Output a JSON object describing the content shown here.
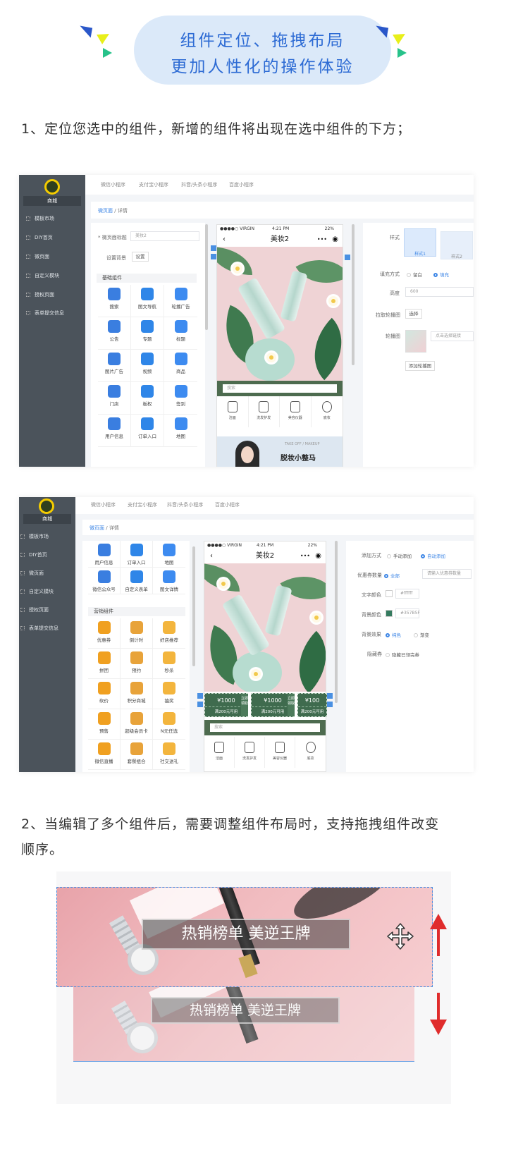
{
  "header": {
    "line1": "组件定位、拖拽布局",
    "line2": "更加人性化的操作体验",
    "accent": "#2d6bd4"
  },
  "captions": {
    "one": "1、定位您选中的组件，新增的组件将出现在选中组件的下方；",
    "two_a": "2、当编辑了多个组件后，需要调整组件布局时，支持拖拽组件改变",
    "two_b": "顺序。"
  },
  "sidebar": {
    "store": "商城",
    "items": [
      "模板市场",
      "DIY首页",
      "微页面",
      "自定义模块",
      "授权页面",
      "表单提交信息"
    ]
  },
  "topbar": {
    "tabs": [
      "微信小程序",
      "支付宝小程序",
      "抖音/头条小程序",
      "百度小程序"
    ]
  },
  "breadcrumb": {
    "parent": "微页面",
    "sep": "/",
    "current": "详情"
  },
  "shot1": {
    "form": {
      "title_label": "* 微页面标题",
      "title_value": "美妆2",
      "bg_label": "设置背景",
      "bg_button": "设置"
    },
    "section": "基础组件",
    "widgets": [
      "搜索",
      "图文导航",
      "轮播广告",
      "公告",
      "专题",
      "标题",
      "图片广告",
      "视频",
      "商品",
      "门店",
      "板权",
      "签到",
      "用户信息",
      "订单入口",
      "地图"
    ],
    "right": {
      "style_label": "样式",
      "style1": "样式1",
      "style2": "样式2",
      "fill_label": "填充方式",
      "fill_opt1": "留白",
      "fill_opt2": "填充",
      "height_label": "高度",
      "height_value": "600",
      "pick_label": "拉取轮播图",
      "pick_button": "选择",
      "carousel_label": "轮播图",
      "carousel_hint": "点击选择链接",
      "add_button": "添加轮播图"
    }
  },
  "shot2": {
    "widgets_top": [
      "用户信息",
      "订单入口",
      "地图",
      "微信公众号",
      "自定义表单",
      "图文详情"
    ],
    "section": "营销组件",
    "widgets": [
      "优惠券",
      "倒计时",
      "好店推荐",
      "拼团",
      "预约",
      "秒杀",
      "砍价",
      "积分商城",
      "抽奖",
      "预售",
      "超级会员卡",
      "N元任选",
      "微信直播",
      "套餐组合",
      "社交送礼"
    ],
    "right": {
      "add_label": "添加方式",
      "add_opt1": "手动添加",
      "add_opt2": "自动添加",
      "count_label": "优惠券数量",
      "count_opt1": "全部",
      "count_hint": "请输入优惠券数量",
      "text_color_label": "文字颜色",
      "text_color_value": "#ffffff",
      "bg_color_label": "背景颜色",
      "bg_color_value": "#357B5F",
      "bg_effect_label": "背景效果",
      "bg_effect_opt1": "纯色",
      "bg_effect_opt2": "渐变",
      "hide_label": "隐藏券",
      "hide_opt": "隐藏已领完券"
    },
    "coupons": [
      {
        "amount": "¥1000",
        "cond": "满200元可用",
        "get": "立即领取"
      },
      {
        "amount": "¥1000",
        "cond": "满200元可用",
        "get": "立即领取"
      },
      {
        "amount": "¥1000",
        "cond": "满200元可用",
        "get": "立即领取"
      },
      {
        "amount": "¥100",
        "cond": "满200元可用",
        "get": ""
      }
    ]
  },
  "phone": {
    "carrier": "●●●●○ VIRGIN",
    "time": "4:21 PM",
    "battery": "22%",
    "title": "美妆2",
    "search_placeholder": "搜索",
    "categories": [
      "洁面",
      "洗发护发",
      "美容仪器",
      "底妆"
    ],
    "banner_text": "TAKE OFF / MAKEUP",
    "banner_title": "脱妆小整马"
  },
  "drag": {
    "banner_title": "热销榜单 美逆王牌"
  },
  "colors": {
    "sidebar": "#4b535b",
    "link": "#3d86e6",
    "arrow": "#e02c2c"
  }
}
